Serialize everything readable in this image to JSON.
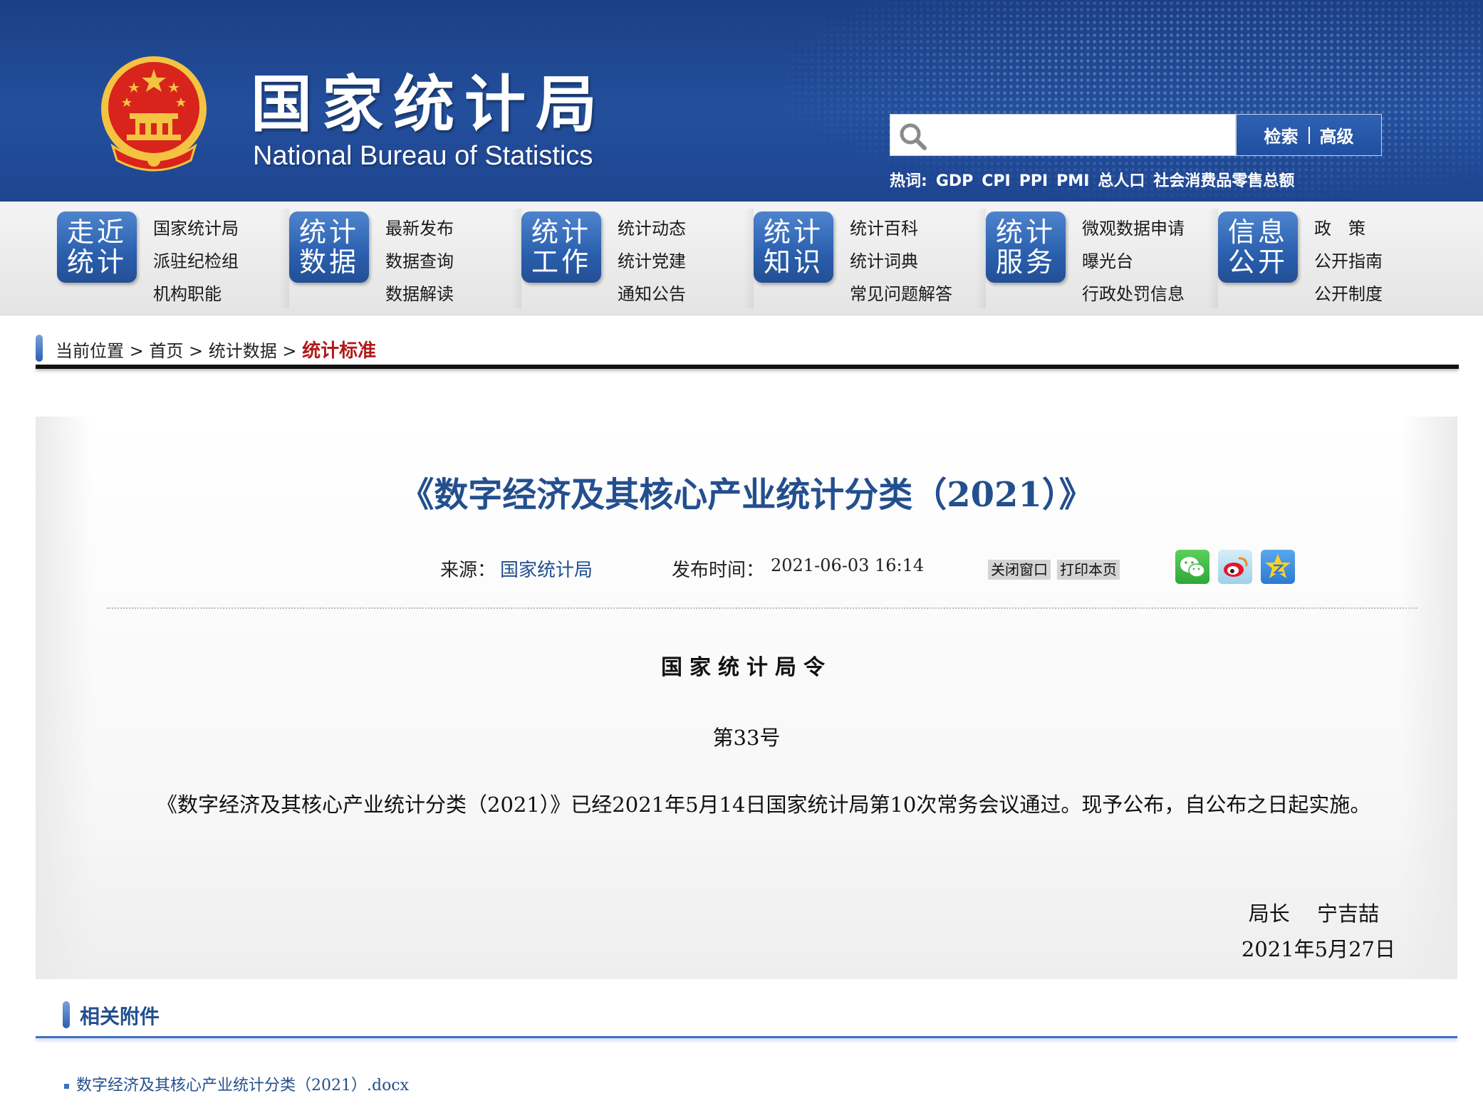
{
  "header": {
    "site_title_cn": "国家统计局",
    "site_title_en": "National Bureau of Statistics",
    "search": {
      "placeholder": "",
      "search_label": "检索",
      "advanced_label": "高级"
    },
    "hotwords": {
      "label": "热词:",
      "items": [
        "GDP",
        "CPI",
        "PPI",
        "PMI",
        "总人口",
        "社会消费品零售总额"
      ]
    }
  },
  "nav": {
    "groups": [
      {
        "badge": [
          "走近",
          "统计"
        ],
        "links": [
          "国家统计局",
          "派驻纪检组",
          "机构职能"
        ]
      },
      {
        "badge": [
          "统计",
          "数据"
        ],
        "links": [
          "最新发布",
          "数据查询",
          "数据解读"
        ]
      },
      {
        "badge": [
          "统计",
          "工作"
        ],
        "links": [
          "统计动态",
          "统计党建",
          "通知公告"
        ]
      },
      {
        "badge": [
          "统计",
          "知识"
        ],
        "links": [
          "统计百科",
          "统计词典",
          "常见问题解答"
        ]
      },
      {
        "badge": [
          "统计",
          "服务"
        ],
        "links": [
          "微观数据申请",
          "曝光台",
          "行政处罚信息"
        ]
      },
      {
        "badge": [
          "信息",
          "公开"
        ],
        "links": [
          "政　策",
          "公开指南",
          "公开制度"
        ]
      }
    ]
  },
  "breadcrumb": {
    "items": [
      "当前位置",
      "首页",
      "统计数据"
    ],
    "separator": " > ",
    "current": "统计标准"
  },
  "article": {
    "title": "《数字经济及其核心产业统计分类（2021）》",
    "source_label": "来源：",
    "source_value": "国家统计局",
    "time_label": "发布时间：",
    "time_value": "2021-06-03 16:14",
    "close_button": "关闭窗口",
    "print_button": "打印本页",
    "share_icons": [
      "wechat-icon",
      "weibo-icon",
      "qzone-icon"
    ],
    "order_title": "国家统计局令",
    "order_number": "第33号",
    "body": "《数字经济及其核心产业统计分类（2021）》已经2021年5月14日国家统计局第10次常务会议通过。现予公布，自公布之日起实施。",
    "signer": "局长　 宁吉喆",
    "sign_date": "2021年5月27日"
  },
  "attachments": {
    "heading": "相关附件",
    "items": [
      "数字经济及其核心产业统计分类（2021）.docx"
    ]
  },
  "colors": {
    "header_blue": "#234f9c",
    "title_blue": "#234f8e",
    "breadcrumb_current_red": "#b01a1a",
    "emblem_red": "#d8241c",
    "emblem_gold": "#f4c342"
  }
}
